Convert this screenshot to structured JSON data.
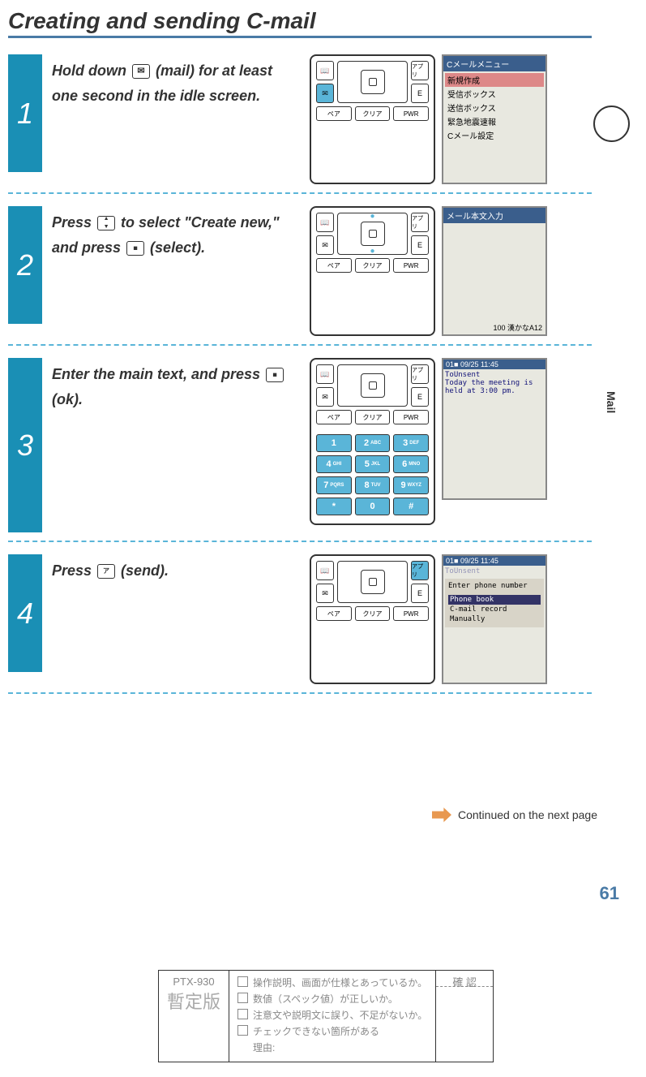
{
  "title": "Creating and sending C-mail",
  "side_tab": "Mail",
  "page_number": "61",
  "continued": "Continued on the next page",
  "steps": [
    {
      "number": "1",
      "text_parts": [
        "Hold down ",
        " (mail) for at least one second in the idle screen."
      ],
      "screen": {
        "header": "Cメールメニュー",
        "items": [
          "新規作成",
          "受信ボックス",
          "送信ボックス",
          "緊急地震速報",
          "Cメール設定"
        ],
        "selected_index": 0
      }
    },
    {
      "number": "2",
      "text_parts": [
        "Press ",
        " to select \"Create new,\" and press ",
        " (select)."
      ],
      "screen": {
        "header": "メール本文入力",
        "footer": "100 漢かなA12"
      }
    },
    {
      "number": "3",
      "text_parts": [
        "Enter the main text, and press ",
        " (ok)."
      ],
      "screen": {
        "header_line": "01■ 09/25 11:45",
        "to": "ToUnsent",
        "body": "Today the meeting is held at 3:00 pm."
      },
      "numpad": [
        [
          "1",
          "2 ABC",
          "3 DEF"
        ],
        [
          "4 GHI",
          "5 JKL",
          "6 MNO"
        ],
        [
          "7 PQRS",
          "8 TUV",
          "9 WXYZ"
        ],
        [
          "*",
          "0",
          "#"
        ]
      ]
    },
    {
      "number": "4",
      "text_parts": [
        "Press ",
        " (send)."
      ],
      "screen": {
        "header_line": "01■ 09/25 11:45",
        "to": "ToUnsent",
        "prompt": "Enter phone number",
        "options": [
          "Phone book",
          "C-mail record",
          "Manually"
        ],
        "selected_index": 0
      }
    }
  ],
  "keypad_labels": {
    "soft_left_top": "📖",
    "soft_left_bottom": "✉",
    "soft_right_top": "アプリ",
    "soft_right_bottom": "E",
    "call": "ペア",
    "clear": "クリア",
    "pwr": "PWR"
  },
  "check_area": {
    "model": "PTX-930",
    "provisional": "暫定版",
    "confirm_label": "確 認",
    "items": [
      "操作説明、画面が仕様とあっているか。",
      "数値（スペック値）が正しいか。",
      "注意文や説明文に誤り、不足がないか。",
      "チェックできない箇所がある"
    ],
    "reason_label": "理由:"
  }
}
